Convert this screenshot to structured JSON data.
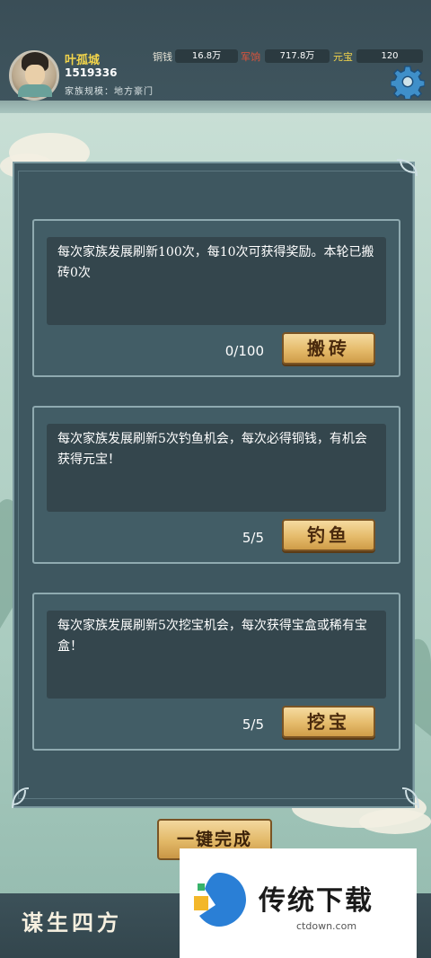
{
  "player": {
    "name": "叶孤城",
    "id": "1519336",
    "scale_label": "家族规模：地方豪门"
  },
  "resources": [
    {
      "label": "铜钱",
      "value": "16.8万",
      "color": "#e9e6d8"
    },
    {
      "label": "军饷",
      "value": "717.8万",
      "color": "#e2543a"
    },
    {
      "label": "元宝",
      "value": "120",
      "color": "#f3d54a"
    }
  ],
  "tasks": [
    {
      "description": "每次家族发展刷新100次，每10次可获得奖励。本轮已搬砖0次",
      "count": "0/100",
      "button": "搬砖"
    },
    {
      "description": "每次家族发展刷新5次钓鱼机会，每次必得铜钱，有机会获得元宝！",
      "count": "5/5",
      "button": "钓鱼"
    },
    {
      "description": "每次家族发展刷新5次挖宝机会，每次获得宝盒或稀有宝盒！",
      "count": "5/5",
      "button": "挖宝"
    }
  ],
  "complete_all_button": "一键完成",
  "bottom_tab": "谋生四方",
  "watermark": {
    "text": "传统下载",
    "url": "ctdown.com"
  },
  "icons": {
    "settings": "gear-icon",
    "avatar": "avatar-portrait"
  }
}
